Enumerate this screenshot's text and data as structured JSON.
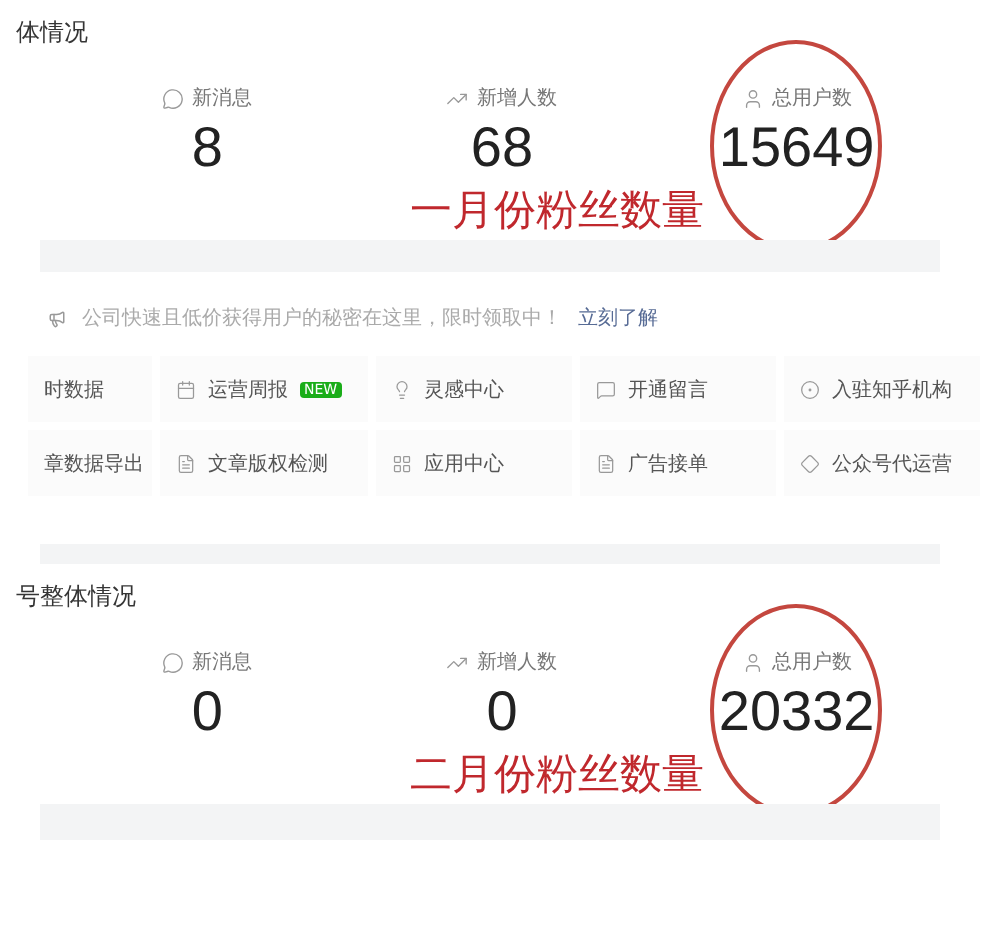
{
  "sections": [
    {
      "kind": "overview",
      "title": "体情况",
      "stats": [
        {
          "label": "新消息",
          "value": "8",
          "circled": false
        },
        {
          "label": "新增人数",
          "value": "68",
          "circled": false
        },
        {
          "label": "总用户数",
          "value": "15649",
          "circled": true
        }
      ],
      "annotation": "一月份粉丝数量"
    },
    {
      "kind": "tools",
      "notice": {
        "text": "公司快速且低价获得用户的秘密在这里，限时领取中！",
        "link": "立刻了解"
      },
      "rows": [
        [
          {
            "label": "时数据"
          },
          {
            "label": "运营周报",
            "badge": "NEW"
          },
          {
            "label": "灵感中心"
          },
          {
            "label": "开通留言"
          },
          {
            "label": "入驻知乎机构"
          }
        ],
        [
          {
            "label": "章数据导出"
          },
          {
            "label": "文章版权检测"
          },
          {
            "label": "应用中心"
          },
          {
            "label": "广告接单"
          },
          {
            "label": "公众号代运营"
          }
        ]
      ]
    },
    {
      "kind": "overview",
      "title": "号整体情况",
      "stats": [
        {
          "label": "新消息",
          "value": "0",
          "circled": false
        },
        {
          "label": "新增人数",
          "value": "0",
          "circled": false
        },
        {
          "label": "总用户数",
          "value": "20332",
          "circled": true
        }
      ],
      "annotation": "二月份粉丝数量"
    }
  ]
}
